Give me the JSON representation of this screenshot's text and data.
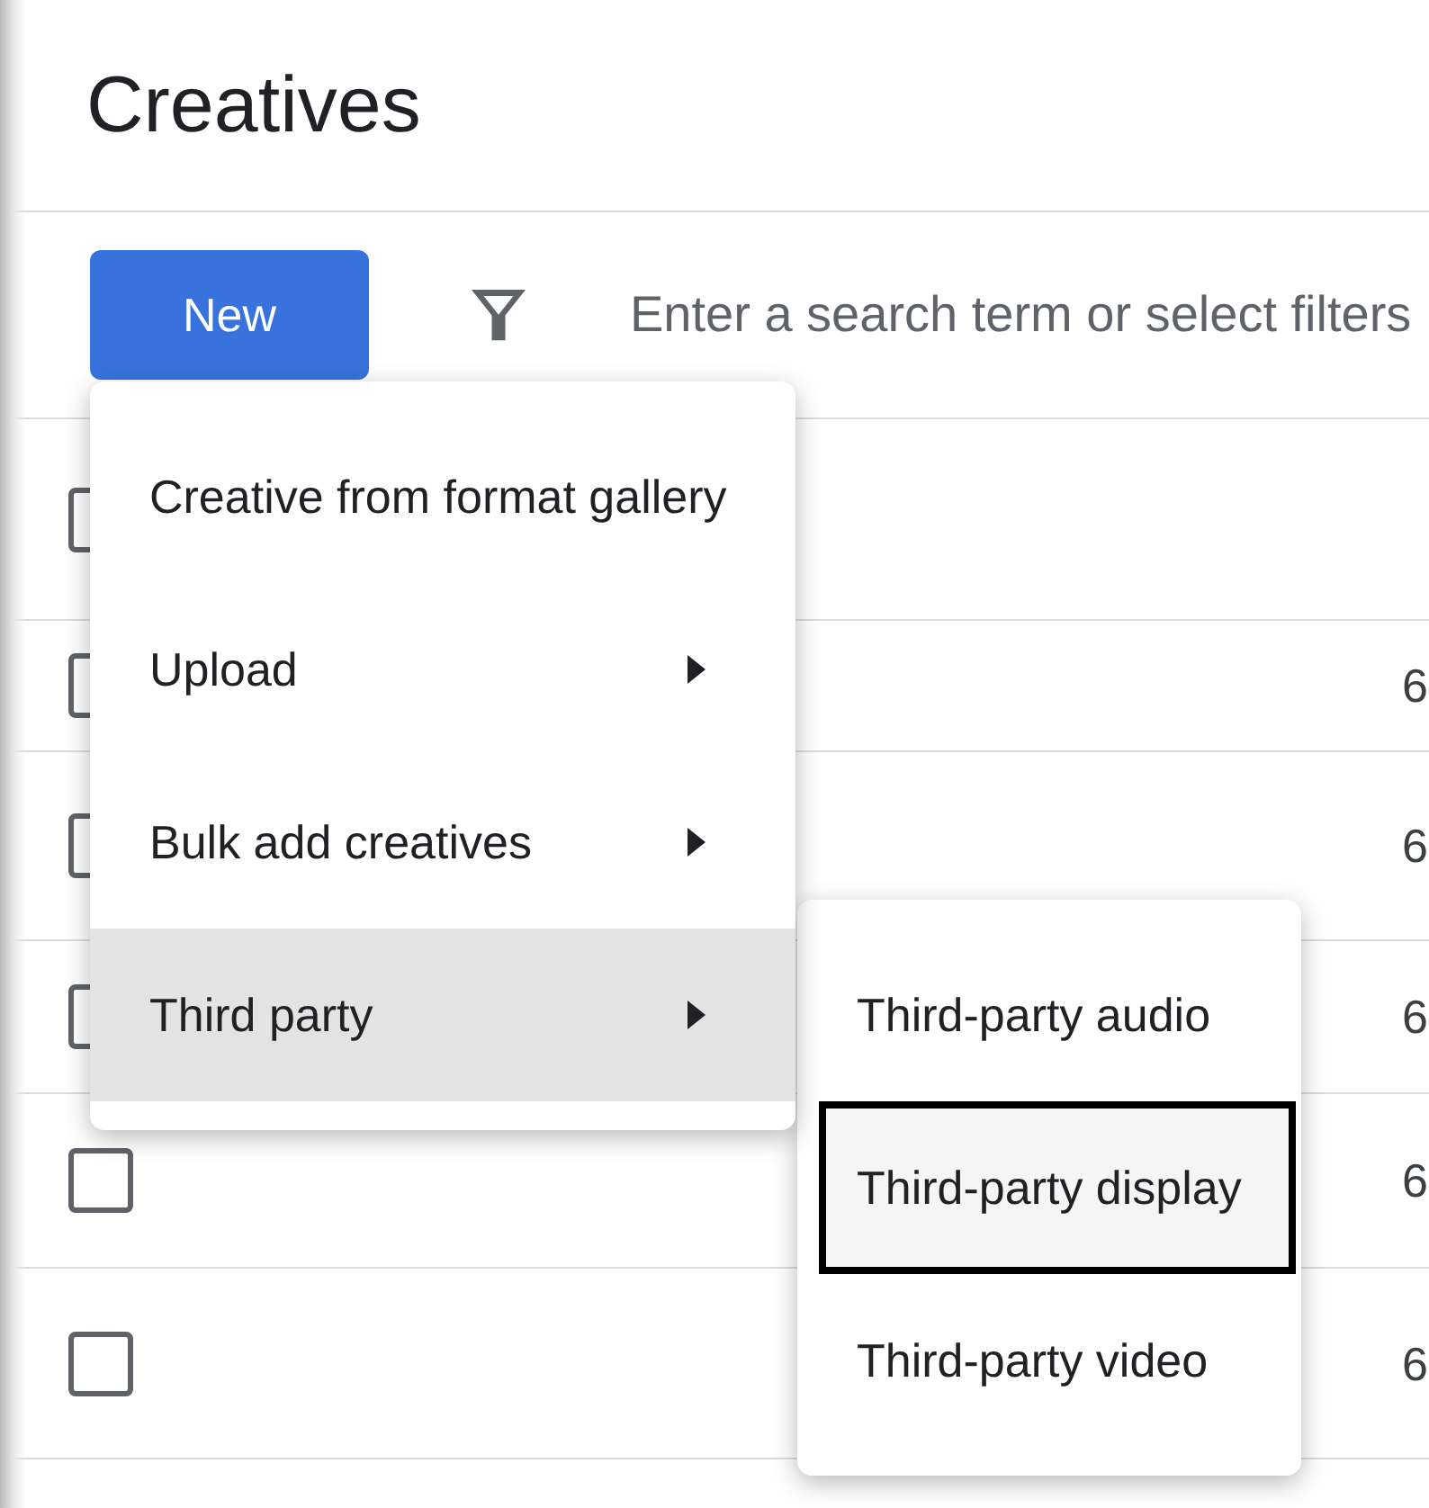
{
  "page": {
    "title": "Creatives"
  },
  "toolbar": {
    "new_button": {
      "label": "New"
    },
    "search": {
      "placeholder": "Enter a search term or select filters"
    }
  },
  "table": {
    "header": {
      "checked": false
    },
    "rows": [
      {
        "checked": false,
        "column_3": "6"
      },
      {
        "checked": false,
        "column_3": "6"
      },
      {
        "checked": false,
        "column_3": "6"
      },
      {
        "checked": false,
        "column_3": "6"
      },
      {
        "checked": false,
        "column_3": "6"
      }
    ]
  },
  "menu": {
    "items": [
      {
        "label": "Creative from format gallery",
        "kind": "action",
        "expanded": false
      },
      {
        "label": "Upload",
        "kind": "submenu",
        "expanded": false
      },
      {
        "label": "Bulk add creatives",
        "kind": "submenu",
        "expanded": false
      },
      {
        "label": "Third party",
        "kind": "submenu",
        "expanded": true,
        "children": [
          {
            "label": "Third-party audio",
            "selected": false
          },
          {
            "label": "Third-party display",
            "selected": true
          },
          {
            "label": "Third-party video",
            "selected": false
          }
        ]
      }
    ]
  }
}
